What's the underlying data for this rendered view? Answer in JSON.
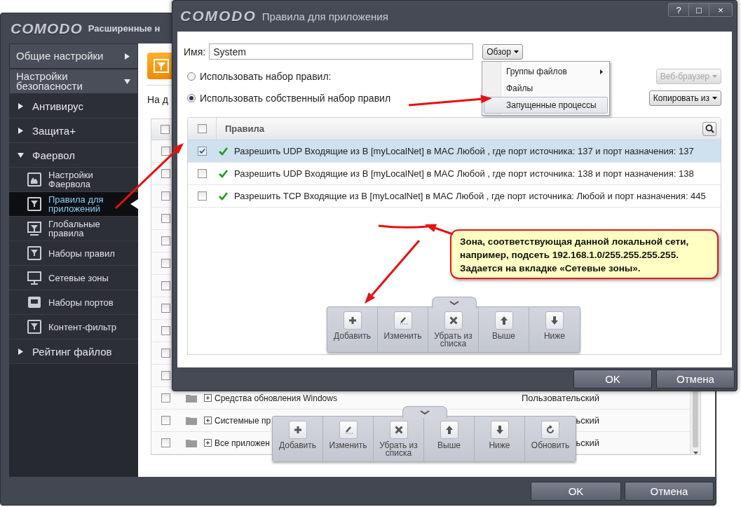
{
  "main_window": {
    "logo": "COMODO",
    "title": "Расширенные н",
    "sidebar": [
      {
        "label": "Общие настройки",
        "kind": "category",
        "expanded": false
      },
      {
        "label": "Настройки безопасности",
        "kind": "category",
        "expanded": true,
        "children": [
          {
            "label": "Антивирус",
            "kind": "section",
            "expanded": false
          },
          {
            "label": "Защита+",
            "kind": "section",
            "expanded": false
          },
          {
            "label": "Фаервол",
            "kind": "section",
            "expanded": true,
            "children": [
              {
                "label": "Настройки Фаервола",
                "kind": "settings",
                "selected": false
              },
              {
                "label": "Правила для приложений",
                "kind": "app-rules",
                "selected": true
              },
              {
                "label": "Глобальные правила",
                "kind": "global-rules",
                "selected": false
              },
              {
                "label": "Наборы правил",
                "kind": "rulesets",
                "selected": false
              },
              {
                "label": "Сетевые зоны",
                "kind": "zones",
                "selected": false
              },
              {
                "label": "Наборы портов",
                "kind": "ports",
                "selected": false
              },
              {
                "label": "Контент-фильтр",
                "kind": "filter",
                "selected": false
              }
            ]
          },
          {
            "label": "Рейтинг файлов",
            "kind": "section",
            "expanded": false
          }
        ]
      }
    ],
    "intro": "На д",
    "table": {
      "header_checked": false,
      "rows": [
        {
          "checked": false
        },
        {
          "checked": false
        },
        {
          "checked": false
        },
        {
          "checked": false
        },
        {
          "checked": false
        },
        {
          "checked": false
        },
        {
          "checked": false
        },
        {
          "checked": false
        },
        {
          "checked": false
        },
        {
          "checked": false
        },
        {
          "checked": false
        },
        {
          "checked": false,
          "expanded": false,
          "name": "Средства обновления Windows",
          "type": "Пользовательский"
        },
        {
          "checked": false,
          "expanded": false,
          "name": "Системные пр",
          "type": "ьский"
        },
        {
          "checked": false,
          "expanded": false,
          "name": "Все приложен",
          "type": "ьский"
        }
      ]
    },
    "toolbar": [
      {
        "kind": "add",
        "label": "Добавить"
      },
      {
        "kind": "edit",
        "label": "Изменить"
      },
      {
        "kind": "remove",
        "label": "Убрать из списка"
      },
      {
        "kind": "up",
        "label": "Выше"
      },
      {
        "kind": "down",
        "label": "Ниже"
      },
      {
        "kind": "refresh",
        "label": "Обновить"
      }
    ],
    "buttons": [
      "OK",
      "Отмена"
    ]
  },
  "dialog": {
    "logo": "COMODO",
    "title": "Правила для приложения",
    "window_buttons": [
      "?",
      "□",
      "×"
    ],
    "name_label": "Имя:",
    "name_value": "System",
    "browse_button": "Обзор",
    "browse_menu": [
      {
        "label": "Группы файлов",
        "submenu": true,
        "selected": false
      },
      {
        "label": "Файлы",
        "submenu": false,
        "selected": false
      },
      {
        "label": "Запущенные процессы",
        "submenu": false,
        "selected": true
      }
    ],
    "options": [
      {
        "label": "Использовать набор правил:",
        "selected": false
      },
      {
        "label": "Использовать собственный набор правил",
        "selected": true
      }
    ],
    "side_buttons": [
      {
        "label": "Веб-браузер",
        "disabled": true
      },
      {
        "label": "Копировать из",
        "disabled": false
      }
    ],
    "rules": {
      "header": "Правила",
      "header_checked": false,
      "rows": [
        {
          "checked": true,
          "selected": true,
          "text": "Разрешить UDP Входящие из В [myLocalNet] в MAC Любой , где порт источника: 137 и порт назначения: 137"
        },
        {
          "checked": false,
          "selected": false,
          "text": "Разрешить UDP Входящие из В [myLocalNet] в MAC Любой , где порт источника: 138 и порт назначения: 138"
        },
        {
          "checked": false,
          "selected": false,
          "text": "Разрешить TCP Входящие из В [myLocalNet] в MAC Любой , где порт источника: Любой и порт назначения: 445"
        }
      ]
    },
    "toolbar": [
      {
        "kind": "add",
        "label": "Добавить"
      },
      {
        "kind": "edit",
        "label": "Изменить"
      },
      {
        "kind": "remove",
        "label": "Убрать из списка"
      },
      {
        "kind": "up",
        "label": "Выше"
      },
      {
        "kind": "down",
        "label": "Ниже"
      }
    ],
    "buttons": [
      "OK",
      "Отмена"
    ]
  },
  "annotation": {
    "callout": [
      "Зона, соответствующая данной локальной сети,",
      "например, подсеть 192.168.1.0/255.255.255.255.",
      "Задается на вкладке «Сетевые зоны»."
    ]
  }
}
